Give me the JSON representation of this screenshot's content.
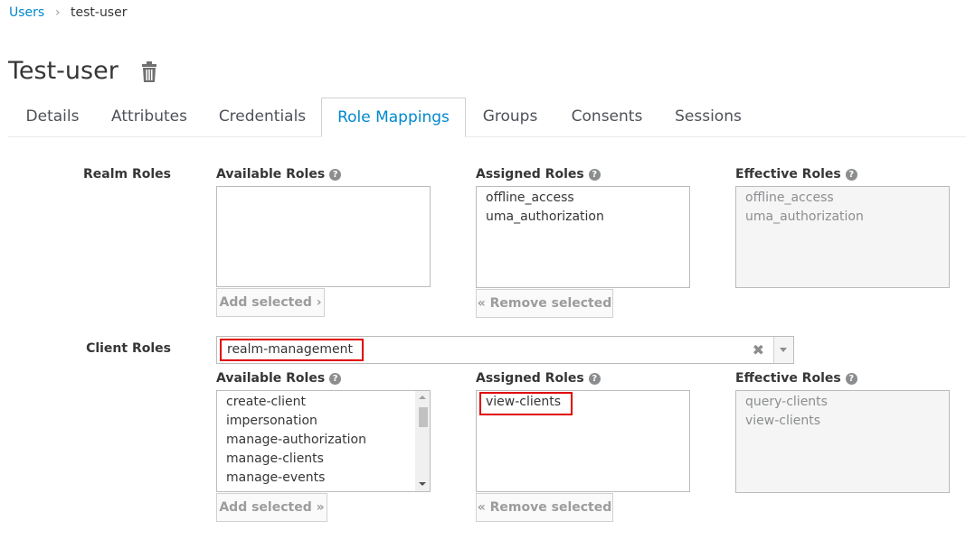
{
  "breadcrumb": {
    "parent": "Users",
    "separator": "›",
    "current": "test-user"
  },
  "page_title": "Test-user",
  "tabs": [
    {
      "label": "Details",
      "active": false
    },
    {
      "label": "Attributes",
      "active": false
    },
    {
      "label": "Credentials",
      "active": false
    },
    {
      "label": "Role Mappings",
      "active": true
    },
    {
      "label": "Groups",
      "active": false
    },
    {
      "label": "Consents",
      "active": false
    },
    {
      "label": "Sessions",
      "active": false
    }
  ],
  "realm_roles": {
    "label": "Realm Roles",
    "available_label": "Available Roles",
    "assigned_label": "Assigned Roles",
    "effective_label": "Effective Roles",
    "available": [],
    "assigned": [
      "offline_access",
      "uma_authorization"
    ],
    "effective": [
      "offline_access",
      "uma_authorization"
    ],
    "add_button": "Add selected ›",
    "remove_button": "« Remove selected"
  },
  "client_roles": {
    "label": "Client Roles",
    "client_select_value": "realm-management",
    "clear_glyph": "✖",
    "available_label": "Available Roles",
    "assigned_label": "Assigned Roles",
    "effective_label": "Effective Roles",
    "available": [
      "create-client",
      "impersonation",
      "manage-authorization",
      "manage-clients",
      "manage-events"
    ],
    "assigned": [
      "view-clients"
    ],
    "effective": [
      "query-clients",
      "view-clients"
    ],
    "add_button": "Add selected »",
    "remove_button": "« Remove selected"
  },
  "help_glyph": "?",
  "colors": {
    "link": "#0088ce",
    "highlight": "#e00000"
  }
}
